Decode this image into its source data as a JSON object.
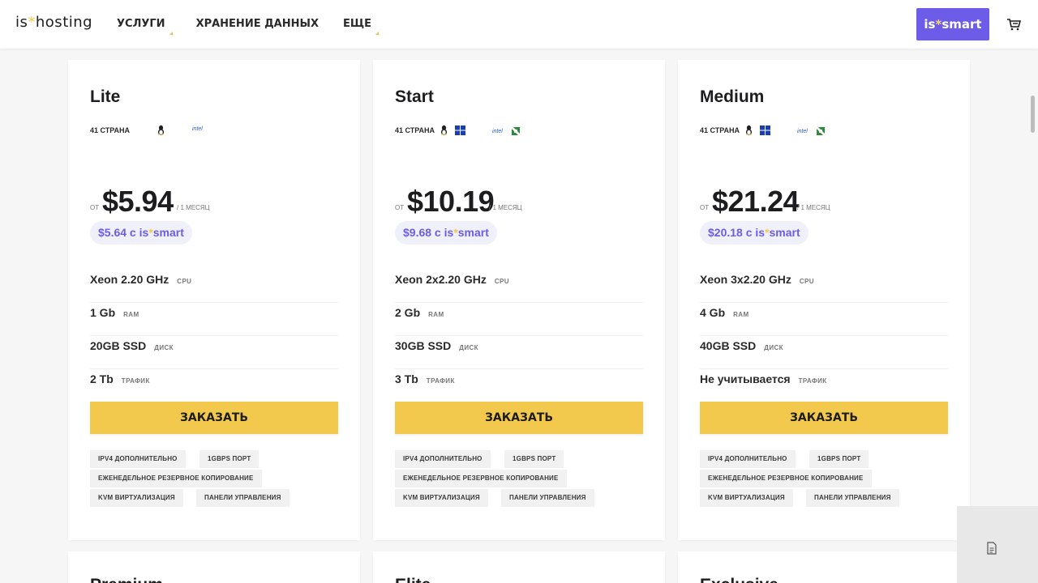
{
  "header": {
    "logo_prefix": "is",
    "logo_star": "*",
    "logo_suffix": "hosting",
    "nav": [
      "УСЛУГИ",
      "ХРАНЕНИЕ ДАННЫХ",
      "ЕЩЕ"
    ],
    "smart_button_prefix": "is",
    "smart_button_star": "*",
    "smart_button_suffix": "smart",
    "cart_icon": "cart-icon"
  },
  "plans": [
    {
      "name": "Lite",
      "countries": "41 СТРАНА",
      "os": [
        "linux-icon"
      ],
      "cpu_vendors": [
        "intel"
      ],
      "from_label": "ОТ",
      "price": "$5.94",
      "period": "/ 1 МЕСЯЦ",
      "smart_price": "$5.64 с is",
      "smart_star": "*",
      "smart_suffix": "smart",
      "specs": [
        {
          "value": "Xeon 2.20 GHz",
          "label": "CPU"
        },
        {
          "value": "1 Gb",
          "label": "RAM"
        },
        {
          "value": "20GB SSD",
          "label": "ДИСК"
        },
        {
          "value": "2 Tb",
          "label": "ТРАФИК"
        }
      ],
      "order_label": "ЗАКАЗАТЬ",
      "tags": [
        "IPV4 ДОПОЛНИТЕЛЬНО",
        "1GBPS ПОРТ",
        "ЕЖЕНЕДЕЛЬНОЕ РЕЗЕРВНОЕ КОПИРОВАНИЕ",
        "KVM ВИРТУАЛИЗАЦИЯ",
        "ПАНЕЛИ УПРАВЛЕНИЯ"
      ]
    },
    {
      "name": "Start",
      "countries": "41 СТРАНА",
      "os": [
        "linux-icon",
        "windows-icon"
      ],
      "cpu_vendors": [
        "intel",
        "amd"
      ],
      "from_label": "ОТ",
      "price": "$10.19",
      "period": "/ 1 МЕСЯЦ",
      "smart_price": "$9.68 с is",
      "smart_star": "*",
      "smart_suffix": "smart",
      "specs": [
        {
          "value": "Xeon 2x2.20 GHz",
          "label": "CPU"
        },
        {
          "value": "2 Gb",
          "label": "RAM"
        },
        {
          "value": "30GB SSD",
          "label": "ДИСК"
        },
        {
          "value": "3 Tb",
          "label": "ТРАФИК"
        }
      ],
      "order_label": "ЗАКАЗАТЬ",
      "tags": [
        "IPV4 ДОПОЛНИТЕЛЬНО",
        "1GBPS ПОРТ",
        "ЕЖЕНЕДЕЛЬНОЕ РЕЗЕРВНОЕ КОПИРОВАНИЕ",
        "KVM ВИРТУАЛИЗАЦИЯ",
        "ПАНЕЛИ УПРАВЛЕНИЯ"
      ]
    },
    {
      "name": "Medium",
      "countries": "41 СТРАНА",
      "os": [
        "linux-icon",
        "windows-icon"
      ],
      "cpu_vendors": [
        "intel",
        "amd"
      ],
      "from_label": "ОТ",
      "price": "$21.24",
      "period": "/ 1 МЕСЯЦ",
      "smart_price": "$20.18 с is",
      "smart_star": "*",
      "smart_suffix": "smart",
      "specs": [
        {
          "value": "Xeon 3x2.20 GHz",
          "label": "CPU"
        },
        {
          "value": "4 Gb",
          "label": "RAM"
        },
        {
          "value": "40GB SSD",
          "label": "ДИСК"
        },
        {
          "value": "Не учитывается",
          "label": "ТРАФИК"
        }
      ],
      "order_label": "ЗАКАЗАТЬ",
      "tags": [
        "IPV4 ДОПОЛНИТЕЛЬНО",
        "1GBPS ПОРТ",
        "ЕЖЕНЕДЕЛЬНОЕ РЕЗЕРВНОЕ КОПИРОВАНИЕ",
        "KVM ВИРТУАЛИЗАЦИЯ",
        "ПАНЕЛИ УПРАВЛЕНИЯ"
      ]
    }
  ],
  "next_row_partial": [
    "Premium",
    "Elite",
    "Exclusive"
  ],
  "colors": {
    "accent": "#6c5ce7",
    "button": "#f2c94c",
    "star": "#f2c94c"
  },
  "side_panel_icon": "document-icon"
}
